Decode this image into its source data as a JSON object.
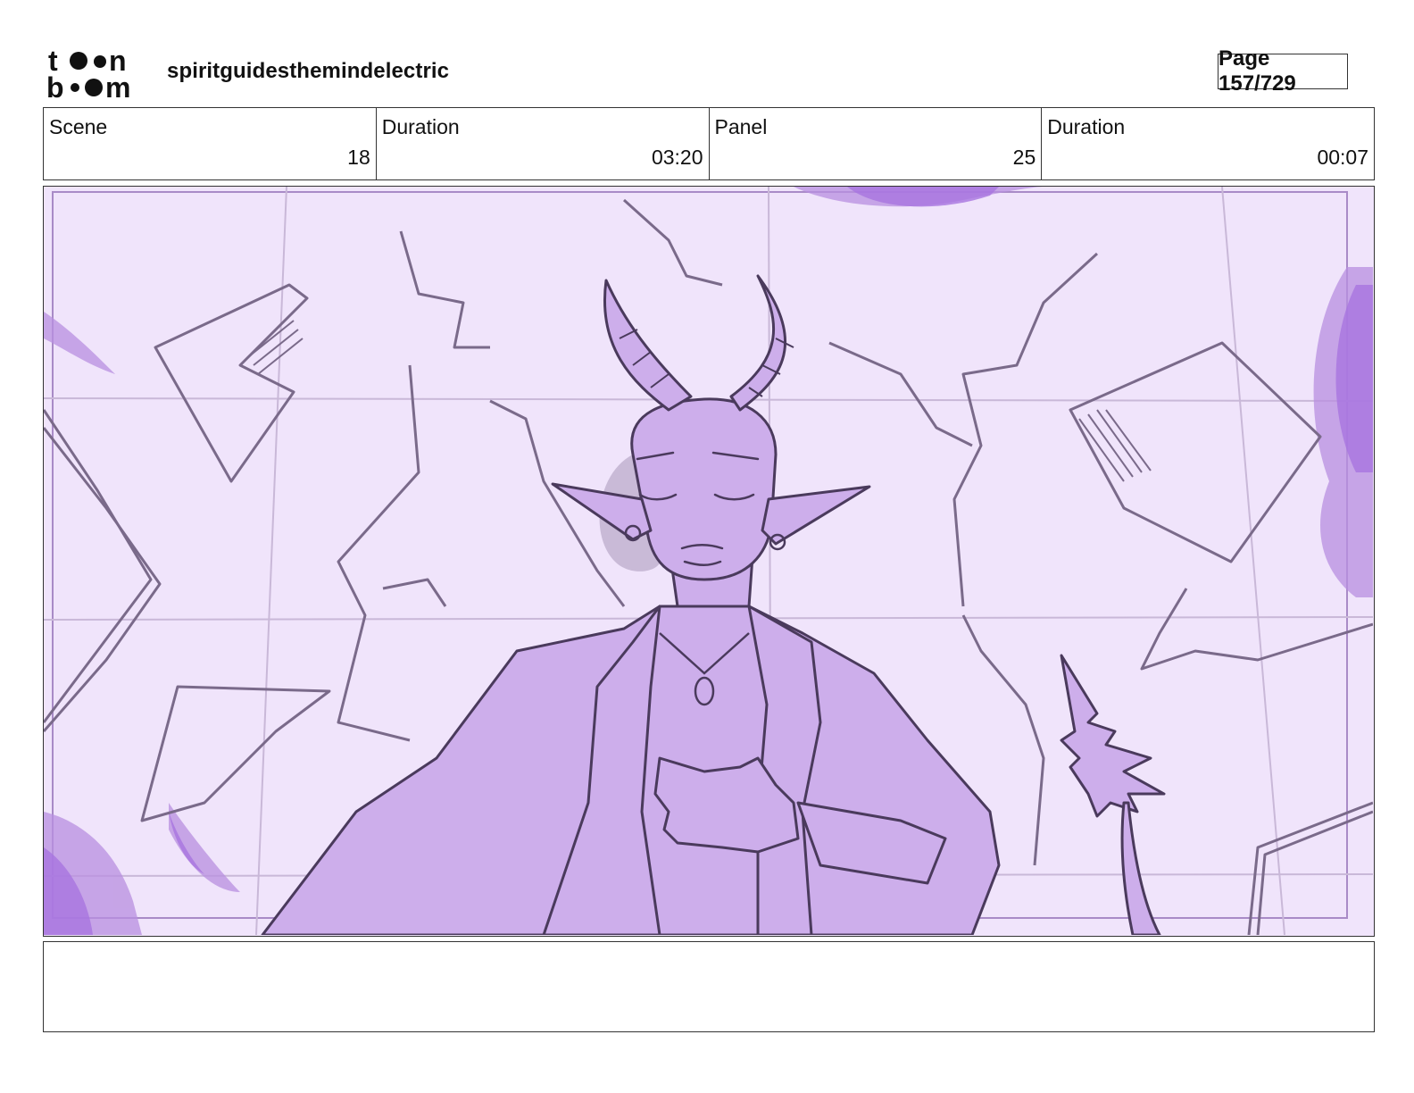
{
  "header": {
    "logo_text_top": "toon",
    "logo_text_bottom": "boom",
    "project_title": "spiritguidesthemindelectric",
    "page_label": "Page 157/729"
  },
  "info": [
    {
      "label": "Scene",
      "value": "18"
    },
    {
      "label": "Duration",
      "value": "03:20"
    },
    {
      "label": "Panel",
      "value": "25"
    },
    {
      "label": "Duration",
      "value": "00:07"
    }
  ],
  "panel": {
    "image_name": "demon-character-sketch",
    "background_color": "#f0e4fb",
    "fill_color": "#cdaeeb",
    "accent_color": "#a874e0",
    "line_color": "#4a3a5c"
  },
  "notes": {
    "text": ""
  }
}
